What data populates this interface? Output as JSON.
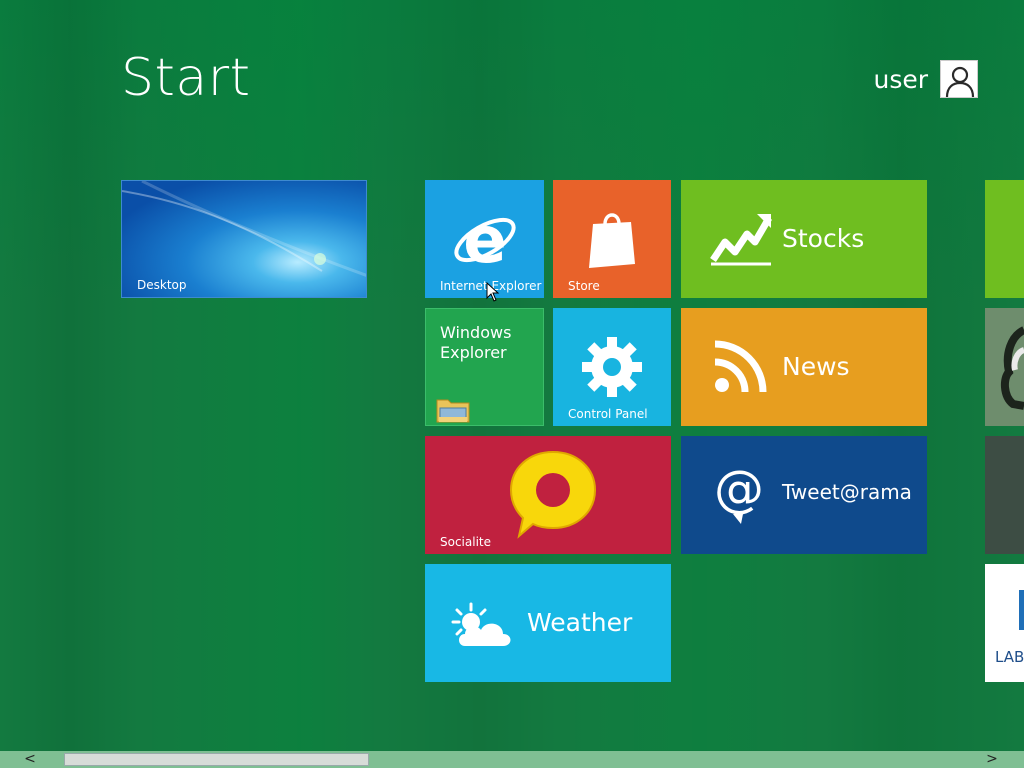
{
  "header": {
    "title": "Start",
    "user_name": "user"
  },
  "tiles": {
    "desktop": "Desktop",
    "internet_explorer": "Internet Explorer",
    "store": "Store",
    "stocks": "Stocks",
    "windows_explorer": "Windows Explorer",
    "control_panel": "Control Panel",
    "news": "News",
    "socialite": "Socialite",
    "tweet": "Tweet@rama",
    "weather": "Weather",
    "partial_bottom": "LAB"
  },
  "icons": {
    "user": "user-avatar-icon",
    "ie": "internet-explorer-icon",
    "store": "shopping-bag-icon",
    "stocks": "stock-chart-icon",
    "folder": "folder-icon",
    "gear": "gear-icon",
    "rss": "rss-icon",
    "speech": "speech-bubble-icon",
    "at": "at-sign-icon",
    "weather": "sun-cloud-icon"
  },
  "scrollbar": {
    "left_arrow": "<",
    "right_arrow": ">",
    "position_fraction": 0.0
  },
  "colors": {
    "background": "#137a40",
    "ie": "#1ba1e2",
    "store": "#e8622a",
    "stocks": "#6fbe20",
    "windows_explorer": "#22a54f",
    "control_panel": "#18b4e0",
    "news": "#e79e1f",
    "socialite": "#c0213f",
    "tweet": "#0f4a8c",
    "weather": "#18b8e5"
  }
}
